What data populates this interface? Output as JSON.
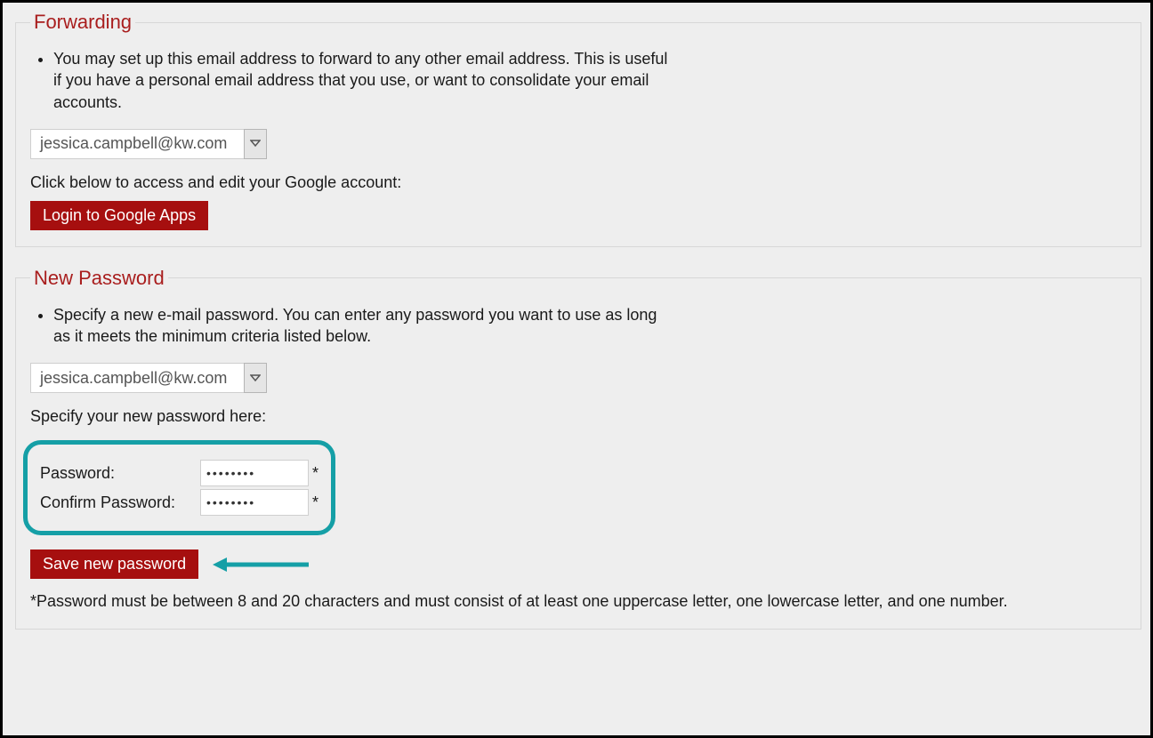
{
  "forwarding": {
    "title": "Forwarding",
    "description": "You may set up this email address to forward to any other email address. This is useful if you have a personal email address that you use, or want to consolidate your email accounts.",
    "email_select": "jessica.campbell@kw.com",
    "access_text": "Click below to access and edit your Google account:",
    "login_button": "Login to Google Apps"
  },
  "newPassword": {
    "title": "New Password",
    "description": "Specify a new e-mail password. You can enter any password you want to use as long as it meets the minimum criteria listed below.",
    "email_select": "jessica.campbell@kw.com",
    "specify_text": "Specify your new password here:",
    "password_label": "Password:",
    "confirm_label": "Confirm Password:",
    "password_value": "••••••••",
    "confirm_value": "••••••••",
    "required_mark": "*",
    "save_button": "Save new password",
    "rules": "*Password must be between 8 and 20 characters and must consist of at least one uppercase letter, one lowercase letter, and one number."
  },
  "colors": {
    "accent_red": "#a60f0f",
    "heading_red": "#a91e1e",
    "annotation_teal": "#159fa6"
  }
}
